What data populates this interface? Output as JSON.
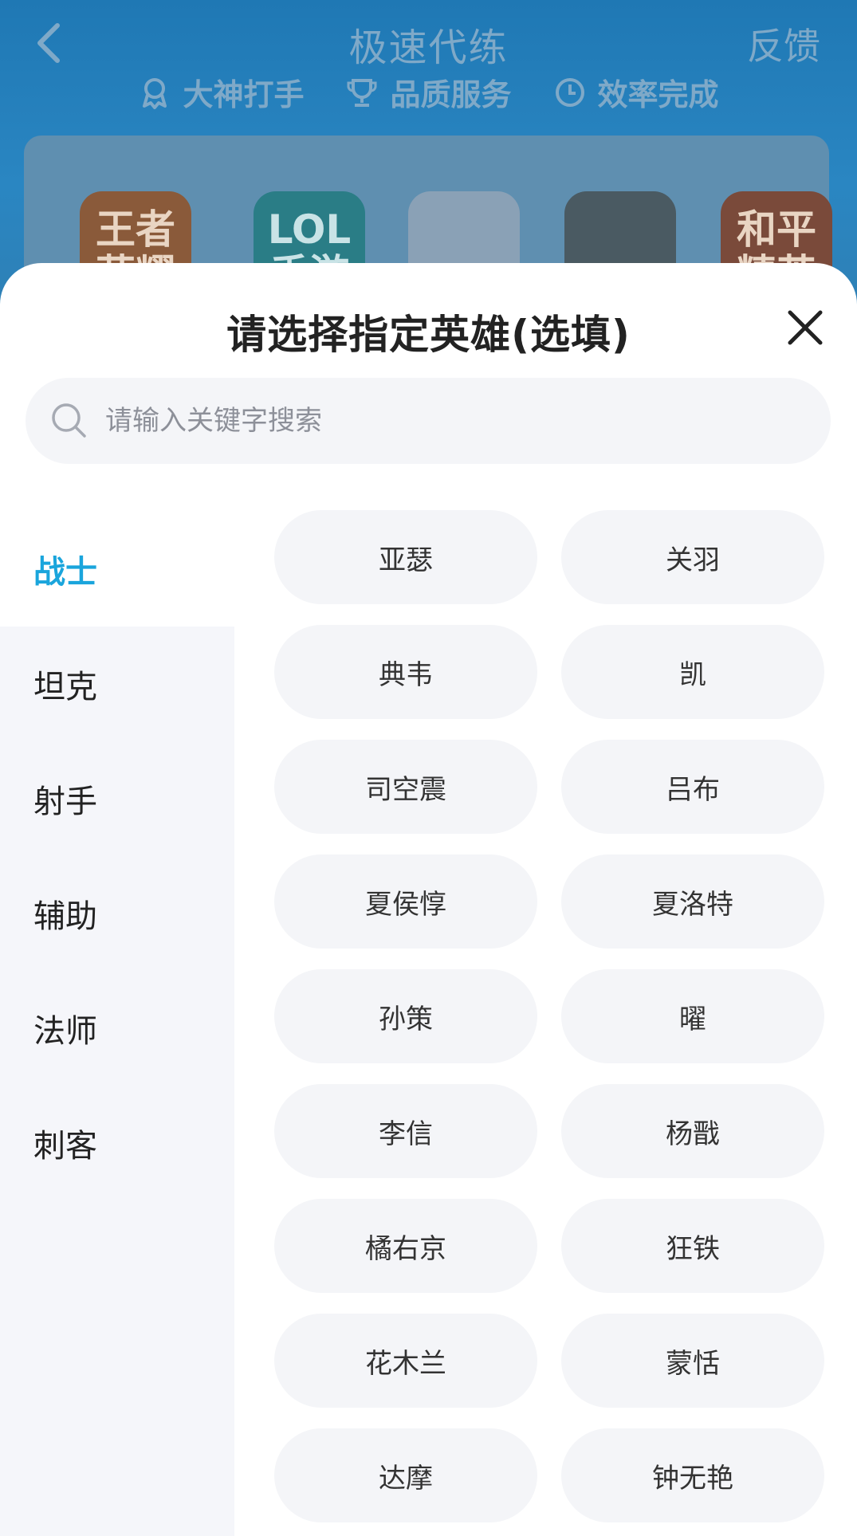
{
  "background": {
    "title": "极速代练",
    "feedback": "反馈",
    "features": [
      {
        "label": "大神打手",
        "icon": "medal-icon"
      },
      {
        "label": "品质服务",
        "icon": "trophy-icon"
      },
      {
        "label": "效率完成",
        "icon": "clock-icon"
      }
    ],
    "games": [
      {
        "line1": "王者",
        "line2": "荣耀"
      },
      {
        "line1": "LOL",
        "line2": "手游"
      },
      {
        "line1": "",
        "line2": ""
      },
      {
        "line1": "",
        "line2": ""
      },
      {
        "line1": "和平",
        "line2": "精英"
      }
    ]
  },
  "modal": {
    "title": "请选择指定英雄(选填)",
    "search_placeholder": "请输入关键字搜索",
    "accent_color": "#1aa5dc",
    "categories": [
      "战士",
      "坦克",
      "射手",
      "辅助",
      "法师",
      "刺客"
    ],
    "active_category": "战士",
    "heroes": [
      "亚瑟",
      "关羽",
      "典韦",
      "凯",
      "司空震",
      "吕布",
      "夏侯惇",
      "夏洛特",
      "孙策",
      "曜",
      "李信",
      "杨戬",
      "橘右京",
      "狂铁",
      "花木兰",
      "蒙恬",
      "达摩",
      "钟无艳"
    ]
  }
}
